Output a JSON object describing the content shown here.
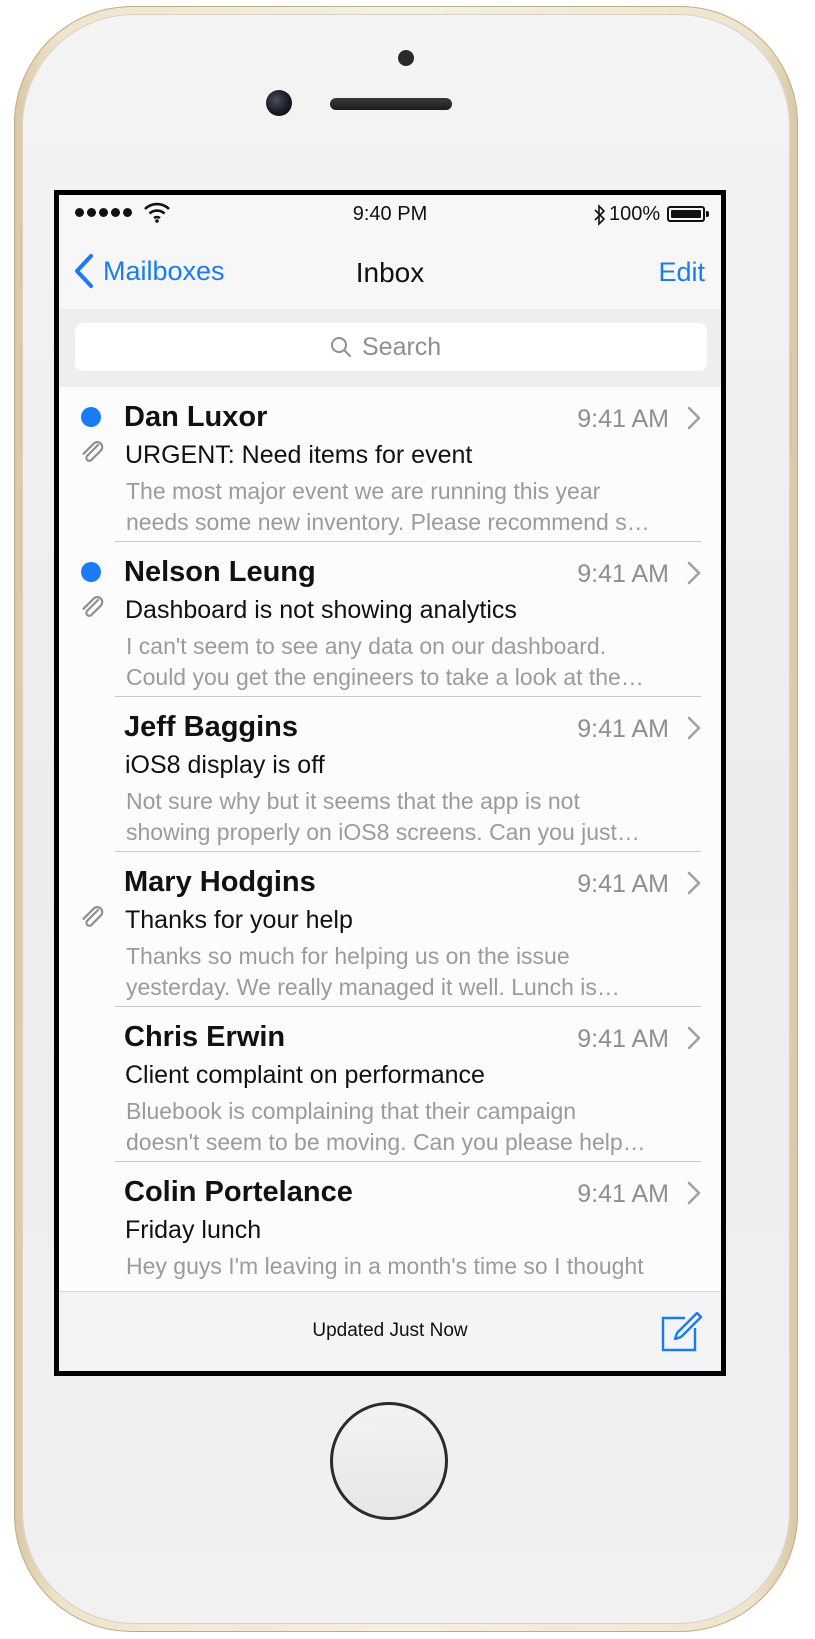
{
  "status_bar": {
    "time": "9:40 PM",
    "battery_percent": "100%",
    "icons": [
      "signal-dots-icon",
      "wifi-icon",
      "bluetooth-icon",
      "battery-icon"
    ]
  },
  "nav": {
    "back_label": "Mailboxes",
    "title": "Inbox",
    "edit_label": "Edit"
  },
  "search": {
    "placeholder": "Search"
  },
  "messages": [
    {
      "sender": "Dan Luxor",
      "time": "9:41 AM",
      "subject": "URGENT: Need items for event",
      "preview_line1": "The most major event we are running this year",
      "preview_line2": "needs some new inventory. Please recommend s…",
      "unread": true,
      "attachment": true
    },
    {
      "sender": "Nelson Leung",
      "time": "9:41 AM",
      "subject": "Dashboard is not showing analytics",
      "preview_line1": "I can't seem to see any data on our dashboard.",
      "preview_line2": "Could you get the engineers to take a look at the…",
      "unread": true,
      "attachment": true
    },
    {
      "sender": "Jeff Baggins",
      "time": "9:41 AM",
      "subject": "iOS8 display is off",
      "preview_line1": "Not sure why but it seems that the app is not",
      "preview_line2": "showing properly on iOS8 screens. Can you just…",
      "unread": false,
      "attachment": false
    },
    {
      "sender": "Mary Hodgins",
      "time": "9:41 AM",
      "subject": "Thanks for your help",
      "preview_line1": "Thanks so much for helping us on the issue",
      "preview_line2": "yesterday. We really managed it well. Lunch is…",
      "unread": false,
      "attachment": true
    },
    {
      "sender": "Chris Erwin",
      "time": "9:41 AM",
      "subject": "Client complaint on performance",
      "preview_line1": "Bluebook is complaining that their campaign",
      "preview_line2": "doesn't seem to be moving. Can you please help…",
      "unread": false,
      "attachment": false
    },
    {
      "sender": "Colin Portelance",
      "time": "9:41 AM",
      "subject": "Friday lunch",
      "preview_line1": "Hey guys I'm leaving in a month's time so I thought",
      "preview_line2": "",
      "unread": false,
      "attachment": false
    }
  ],
  "toolbar": {
    "status": "Updated Just Now",
    "compose_icon": "compose-icon"
  },
  "colors": {
    "accent": "#1a7cf5",
    "unread_dot": "#1a7cf5",
    "secondary_text": "#8e8e93",
    "preview_text": "#9b9b9f",
    "phone_gold": "#e6d6b4"
  }
}
